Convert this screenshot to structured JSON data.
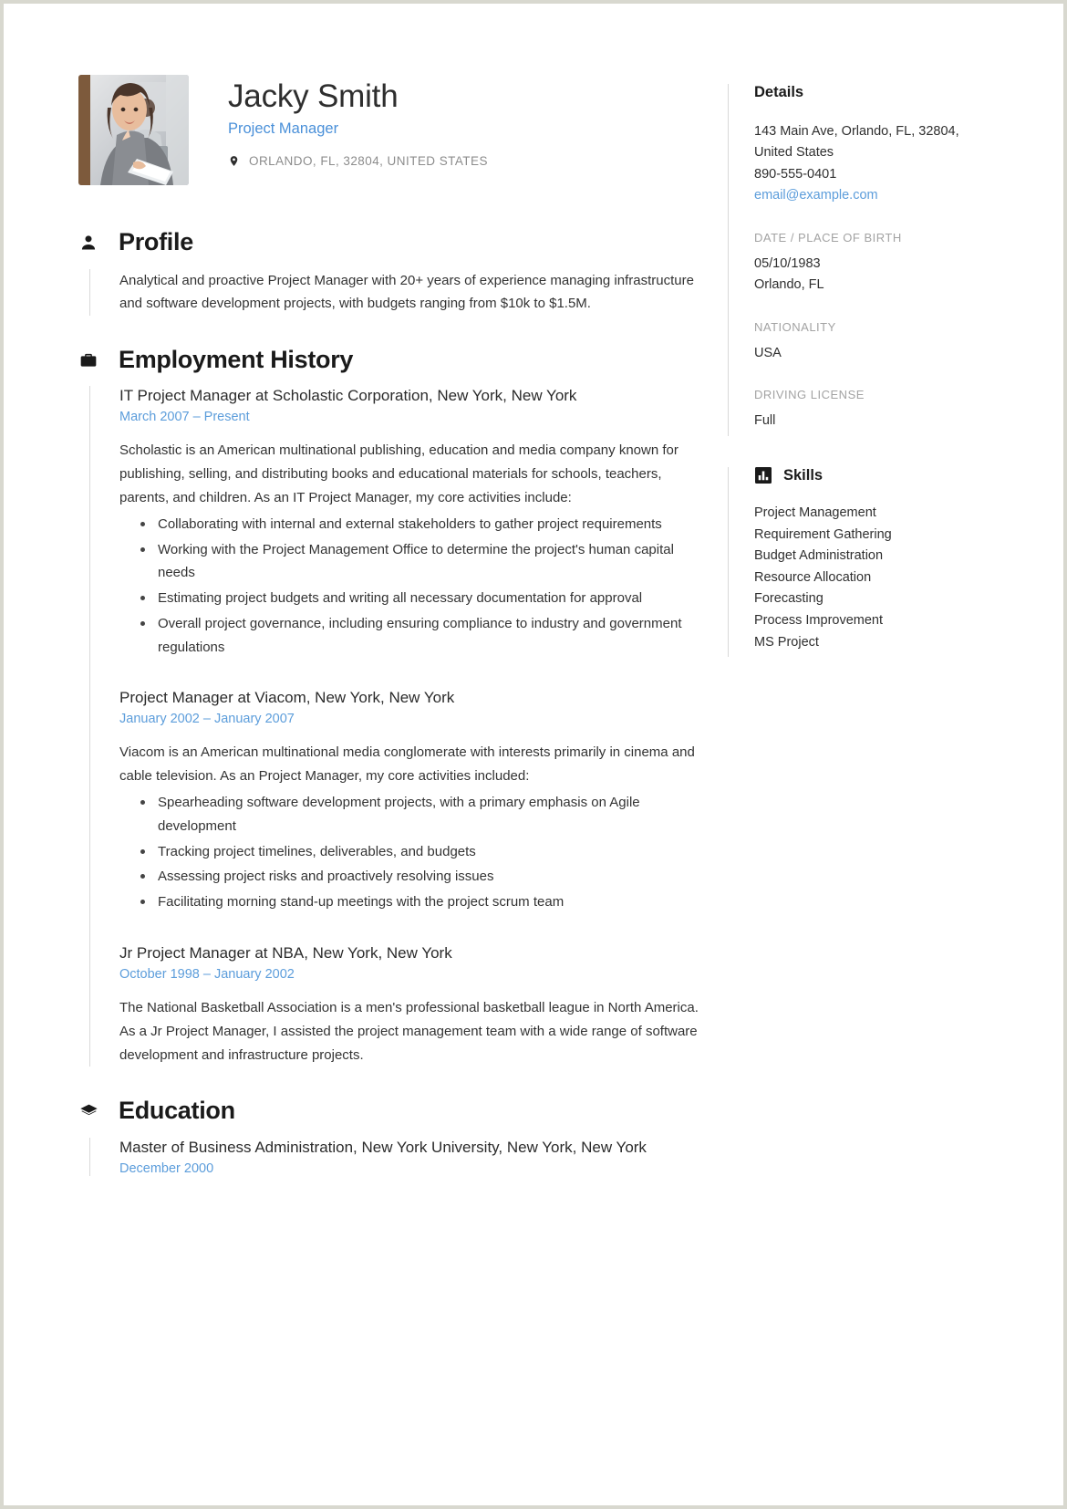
{
  "header": {
    "name": "Jacky Smith",
    "job_title": "Project Manager",
    "location": "ORLANDO, FL, 32804, UNITED STATES",
    "photo_alt": "portrait-photo"
  },
  "sections": {
    "profile": {
      "title": "Profile",
      "icon": "person-icon",
      "text": "Analytical and proactive Project Manager with 20+ years of experience managing infrastructure and software development projects, with budgets ranging from $10k to $1.5M."
    },
    "employment": {
      "title": "Employment History",
      "icon": "briefcase-icon",
      "entries": [
        {
          "title": "IT Project Manager at Scholastic Corporation, New York, New York",
          "date_start": "March 2007",
          "date_sep": "–",
          "date_end": "Present",
          "description": "Scholastic is an American multinational publishing, education and media company known for publishing, selling, and distributing books and educational materials for schools, teachers, parents, and children. As an IT Project Manager, my core activities include:",
          "bullets": [
            "Collaborating with internal and external stakeholders to gather project requirements",
            "Working with the Project Management Office to determine the project's human capital needs",
            "Estimating project budgets and writing all necessary documentation for approval",
            "Overall project governance, including ensuring compliance to industry and government regulations"
          ]
        },
        {
          "title": "Project Manager at Viacom, New York, New York",
          "date_start": "January 2002",
          "date_sep": "–",
          "date_end": "January 2007",
          "description": "Viacom is an American multinational media conglomerate with interests primarily in cinema and cable television. As an Project Manager, my core activities included:",
          "bullets": [
            "Spearheading software development projects, with a primary emphasis on Agile development",
            "Tracking project timelines, deliverables, and budgets",
            "Assessing project risks and proactively resolving issues",
            "Facilitating morning stand-up meetings with the project scrum team"
          ]
        },
        {
          "title": "Jr Project Manager at NBA, New York, New York",
          "date_start": "October 1998",
          "date_sep": "–",
          "date_end": "January 2002",
          "description": "The National Basketball Association is a men's professional basketball league in North America. As a Jr Project Manager, I assisted the project management team with a wide range of software development and infrastructure projects.",
          "bullets": []
        }
      ]
    },
    "education": {
      "title": "Education",
      "icon": "graduation-cap-icon",
      "entries": [
        {
          "title": "Master of Business Administration, New York University, New York, New York",
          "date": "December 2000"
        }
      ]
    }
  },
  "sidebar": {
    "details": {
      "title": "Details",
      "address": "143 Main Ave, Orlando, FL, 32804, United States",
      "phone": "890-555-0401",
      "email": "email@example.com",
      "fields": [
        {
          "label": "DATE / PLACE OF BIRTH",
          "value": "05/10/1983\nOrlando, FL"
        },
        {
          "label": "NATIONALITY",
          "value": "USA"
        },
        {
          "label": "DRIVING LICENSE",
          "value": "Full"
        }
      ]
    },
    "skills": {
      "title": "Skills",
      "icon": "bar-chart-icon",
      "items": [
        "Project Management",
        "Requirement Gathering",
        "Budget Administration",
        "Resource Allocation",
        "Forecasting",
        "Process Improvement",
        "MS Project"
      ]
    }
  },
  "colors": {
    "accent_blue": "#5c9ddb",
    "title_blue": "#4a90d9",
    "text_dark": "#2e2e2e",
    "muted_gray": "#a3a3a3",
    "rule_gray": "#d9d9d9"
  }
}
